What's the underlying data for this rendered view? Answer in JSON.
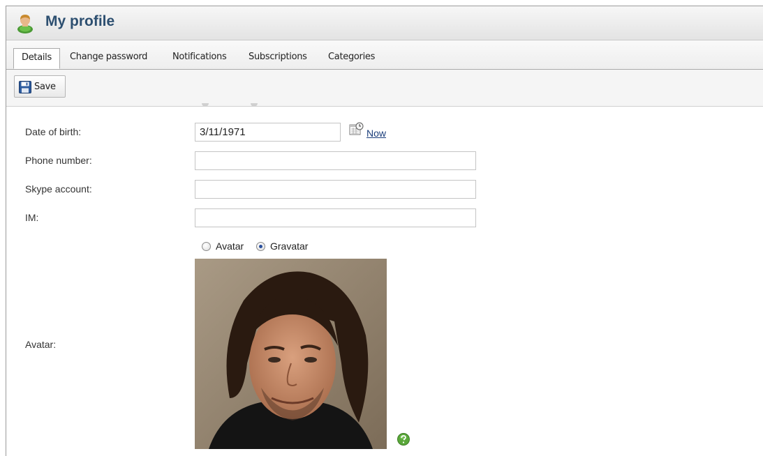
{
  "header": {
    "title": "My profile",
    "icon": "user-profile-icon"
  },
  "tabs": [
    {
      "label": "Details",
      "active": true
    },
    {
      "label": "Change password",
      "active": false
    },
    {
      "label": "Notifications",
      "active": false
    },
    {
      "label": "Subscriptions",
      "active": false
    },
    {
      "label": "Categories",
      "active": false
    }
  ],
  "toolbar": {
    "save_label": "Save",
    "save_icon": "floppy-disk-icon"
  },
  "form": {
    "date_of_birth": {
      "label": "Date of birth:",
      "value": "3/11/1971",
      "now_link": "Now",
      "icon": "calendar-icon"
    },
    "phone": {
      "label": "Phone number:",
      "value": ""
    },
    "skype": {
      "label": "Skype account:",
      "value": ""
    },
    "im": {
      "label": "IM:",
      "value": ""
    },
    "avatar": {
      "label": "Avatar:",
      "options": [
        {
          "label": "Avatar",
          "checked": false
        },
        {
          "label": "Gravatar",
          "checked": true
        }
      ],
      "help_icon": "help-icon"
    }
  },
  "colors": {
    "title": "#2d4f70",
    "link": "#1a3d7a",
    "help": "#5aa83a"
  }
}
